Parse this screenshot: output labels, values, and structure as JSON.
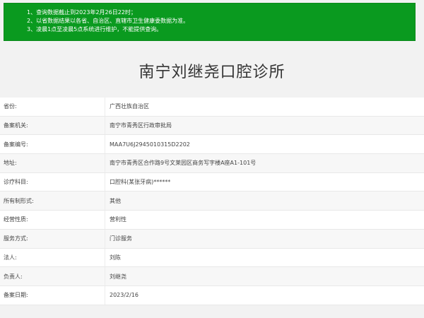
{
  "notice": {
    "lines": [
      "1、查询数据截止到2023年2月26日22时；",
      "2、以省数据结果以各省、自治区、直辖市卫生健康委数据为准。",
      "3、凌晨1点至凌晨5点系统进行维护，不能提供查询。"
    ]
  },
  "title": "南宁刘继尧口腔诊所",
  "rows": [
    {
      "label": "省份:",
      "value": "广西壮族自治区"
    },
    {
      "label": "备案机关:",
      "value": "南宁市青秀区行政审批局"
    },
    {
      "label": "备案编号:",
      "value": "MAA7U6J2945010315D2202"
    },
    {
      "label": "地址:",
      "value": "南宁市青秀区合作路9号文莱园区商务写字楼A座A1-101号"
    },
    {
      "label": "诊疗科目:",
      "value": "口腔科(某张牙病)******"
    },
    {
      "label": "所有制形式:",
      "value": "其他"
    },
    {
      "label": "经营性质:",
      "value": "营利性"
    },
    {
      "label": "服务方式:",
      "value": "门诊服务"
    },
    {
      "label": "法人:",
      "value": "刘陈"
    },
    {
      "label": "负责人:",
      "value": "刘继尧"
    },
    {
      "label": "备案日期:",
      "value": "2023/2/16"
    }
  ]
}
